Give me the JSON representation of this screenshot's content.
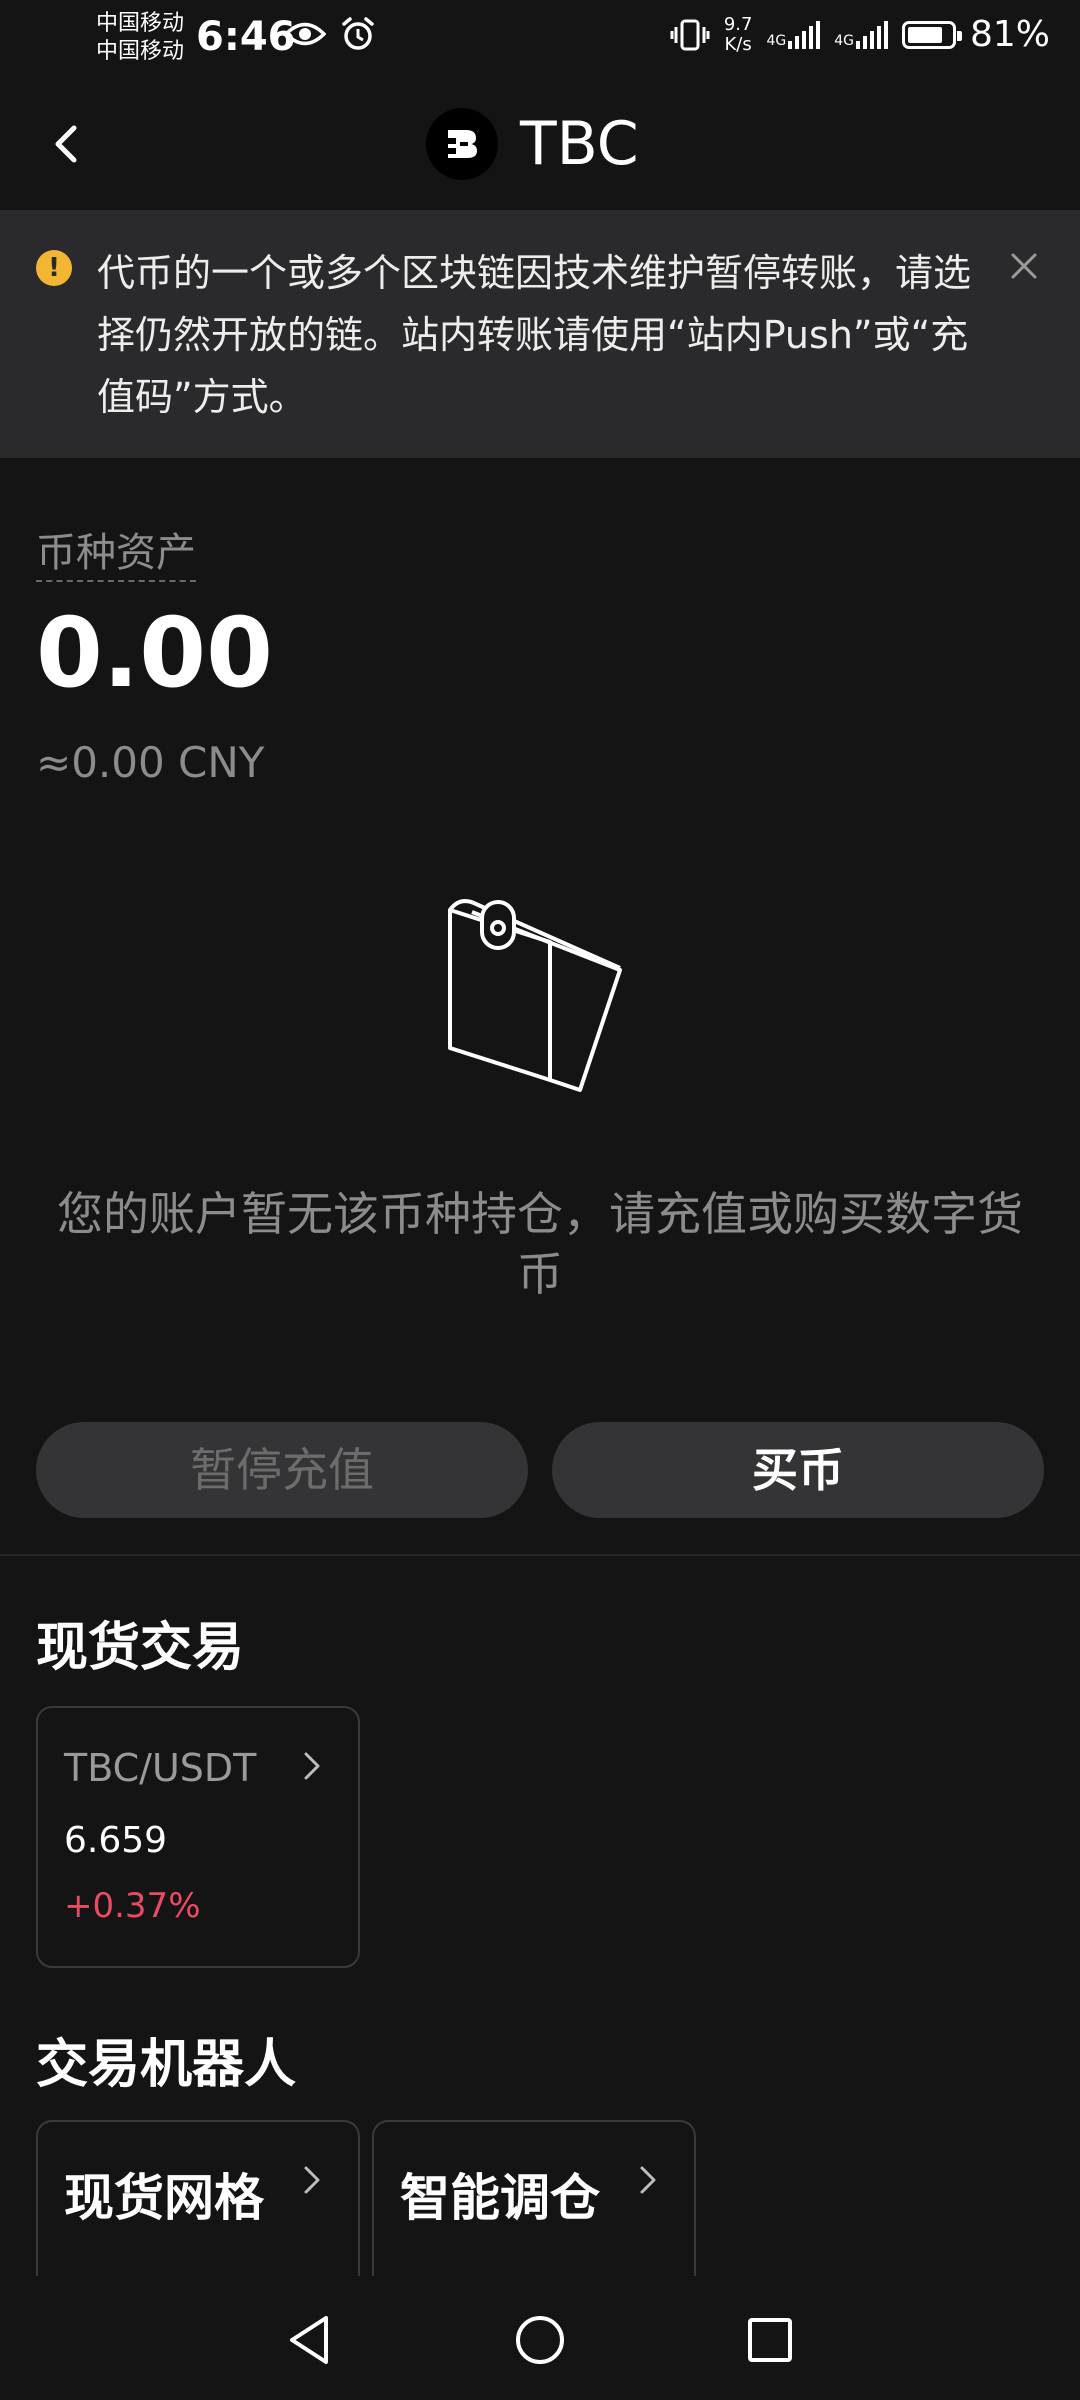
{
  "status_bar": {
    "carrier_1": "中国移动",
    "carrier_2": "中国移动",
    "time": "6:46",
    "net_speed_value": "9.7",
    "net_speed_unit": "K/s",
    "signal_1_label": "4G",
    "signal_2_label": "4G",
    "battery_percent": "81%",
    "battery_level": 0.81
  },
  "header": {
    "title": "TBC"
  },
  "notice": {
    "text": "代币的一个或多个区块链因技术维护暂停转账，请选择仍然开放的链。站内转账请使用“站内Push”或“充值码”方式。"
  },
  "asset": {
    "label": "币种资产",
    "amount": "0.00",
    "cny_value": "≈0.00 CNY"
  },
  "empty_state": {
    "message": "您的账户暂无该币种持仓，请充值或购买数字货币"
  },
  "actions": {
    "deposit_label": "暂停充值",
    "buy_label": "买币"
  },
  "spot": {
    "section_title": "现货交易",
    "pair": "TBC/USDT",
    "price": "6.659",
    "change": "+0.37%"
  },
  "bots": {
    "section_title": "交易机器人",
    "items": [
      {
        "label": "现货网格"
      },
      {
        "label": "智能调仓"
      }
    ]
  },
  "colors": {
    "background": "#141414",
    "notice_bg": "#2a2a2c",
    "warning": "#f2b632",
    "negative_red": "#ea4b63",
    "button_bg": "#343436"
  }
}
